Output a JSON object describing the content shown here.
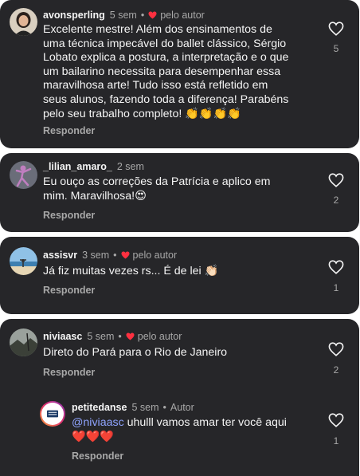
{
  "colors": {
    "card_background": "#262629",
    "page_background": "#ffffff",
    "primary_text": "#f5f5f5",
    "secondary_text": "#a8a8a8",
    "heart_red": "#ff3040",
    "mention_blue": "#8fa4ff"
  },
  "comments": [
    {
      "username": "avonsperling",
      "time": "5 sem",
      "author_label": "pelo autor",
      "text": "Excelente mestre! Além dos ensinamentos de\numa técnica impecável do ballet clássico, Sérgio\nLobato explica a postura, a interpretação e o que\num bailarino necessita para desempenhar essa\nmaravilhosa arte! Tudo isso está refletido em\nseus alunos, fazendo toda a diferença! Parabéns\npelo seu  trabalho completo! 👏👏👏👏",
      "reply_label": "Responder",
      "likes": "5",
      "avatar_icon": "profile-photo-woman-icon"
    },
    {
      "username": "_lilian_amaro_",
      "time": "2 sem",
      "text": "Eu ouço as correções da Patrícia e aplico em\nmim. Maravilhosa!😍",
      "reply_label": "Responder",
      "likes": "2",
      "avatar_icon": "profile-photo-dancer-icon"
    },
    {
      "username": "assisvr",
      "time": "3 sem",
      "author_label": "pelo autor",
      "text": "Já fiz muitas vezes rs... É de lei 👏🏻",
      "reply_label": "Responder",
      "likes": "1",
      "avatar_icon": "profile-photo-beach-icon"
    },
    {
      "username": "niviaasc",
      "time": "5 sem",
      "author_label": "pelo autor",
      "text": "Direto do Pará para o Rio de Janeiro",
      "reply_label": "Responder",
      "likes": "2",
      "avatar_icon": "profile-photo-landscape-icon",
      "replies": [
        {
          "username": "petitedanse",
          "time": "5 sem",
          "author_label": "Autor",
          "mention": "@niviaasc",
          "text": " uhulll vamos amar ter você aqui\n❤️❤️❤️",
          "reply_label": "Responder",
          "likes": "1",
          "avatar_icon": "profile-logo-petite-danse-icon"
        }
      ]
    }
  ]
}
